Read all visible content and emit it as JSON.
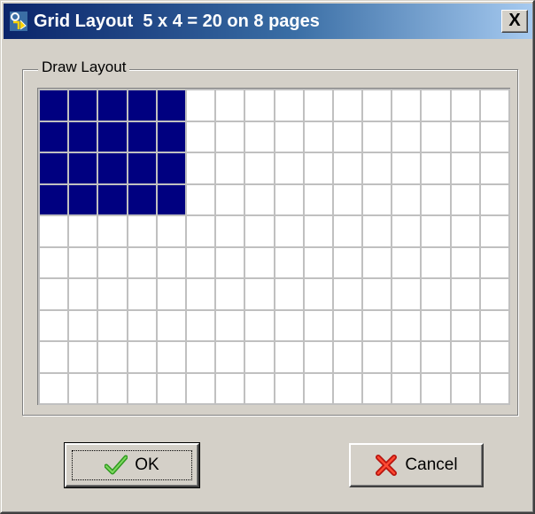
{
  "window": {
    "title": "Grid Layout  5 x 4 = 20 on 8 pages",
    "close_label": "X"
  },
  "group": {
    "label": "Draw Layout"
  },
  "layout_grid": {
    "columns": 16,
    "rows": 10,
    "selected_columns": 5,
    "selected_rows": 4,
    "selected_color": "#000080",
    "empty_color": "#ffffff"
  },
  "buttons": {
    "ok_label": "OK",
    "cancel_label": "Cancel"
  },
  "icons": {
    "title": "layout-app-icon",
    "ok": "checkmark-icon",
    "cancel": "red-x-icon"
  }
}
